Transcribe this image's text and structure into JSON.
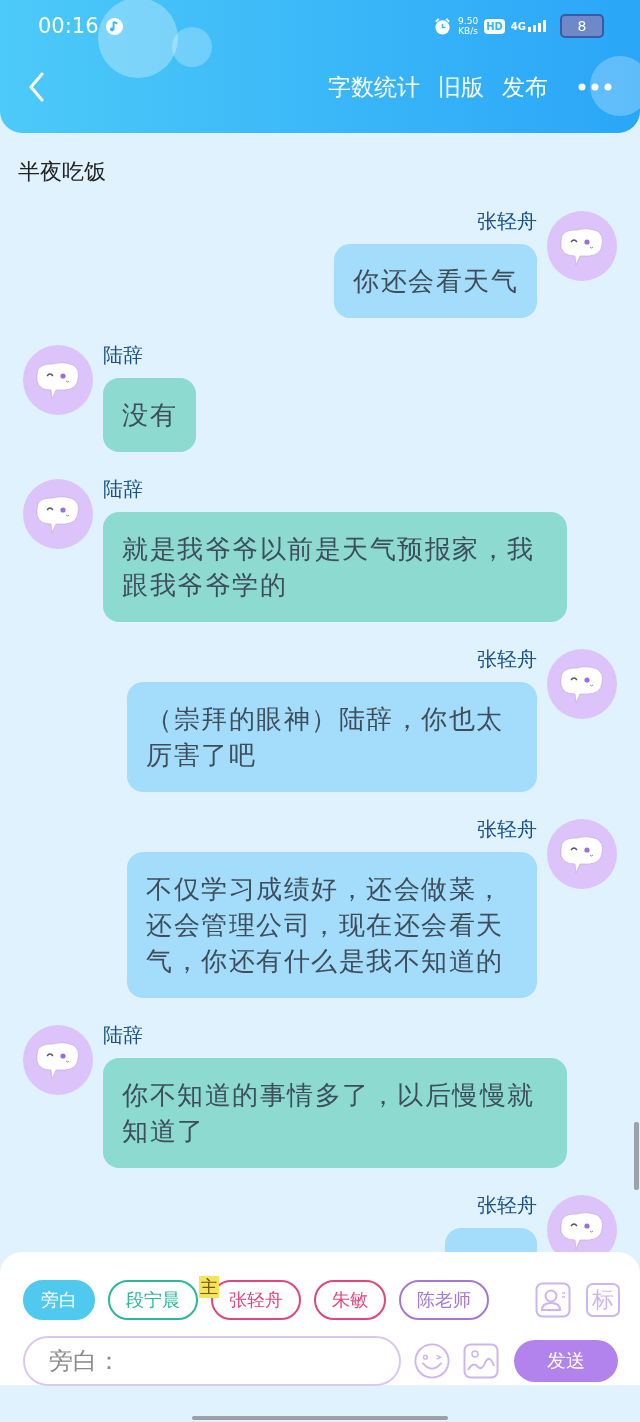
{
  "status_bar": {
    "time": "00:16",
    "net_speed": "9.50",
    "net_unit": "KB/s",
    "hd": "HD",
    "network": "4G",
    "battery": "8"
  },
  "header": {
    "actions": [
      "字数统计",
      "旧版",
      "发布"
    ]
  },
  "narration": "半夜吃饭",
  "messages": [
    {
      "outgoing": true,
      "name": "张轻舟",
      "text": "你还会看天气"
    },
    {
      "outgoing": false,
      "name": "陆辞",
      "text": "没有"
    },
    {
      "outgoing": false,
      "name": "陆辞",
      "text": "就是我爷爷以前是天气预报家，我跟我爷爷学的"
    },
    {
      "outgoing": true,
      "name": "张轻舟",
      "text": "（崇拜的眼神）陆辞，你也太厉害了吧"
    },
    {
      "outgoing": true,
      "name": "张轻舟",
      "text": "不仅学习成绩好，还会做菜，还会管理公司，现在还会看天气，你还有什么是我不知道的"
    },
    {
      "outgoing": false,
      "name": "陆辞",
      "text": "你不知道的事情多了，以后慢慢就知道了"
    },
    {
      "outgoing": true,
      "name": "张轻舟"
    }
  ],
  "roles": [
    {
      "label": "旁白",
      "selected": true,
      "color": "#4fc9ee"
    },
    {
      "label": "段宁晨",
      "selected": false,
      "color": "#2bb79a"
    },
    {
      "label": "张轻舟",
      "selected": false,
      "color": "#e0457f",
      "badge": "主"
    },
    {
      "label": "朱敏",
      "selected": false,
      "color": "#e0457f"
    },
    {
      "label": "陈老师",
      "selected": false,
      "color": "#a678d0"
    }
  ],
  "mark_button": "标",
  "input": {
    "placeholder": "旁白："
  },
  "send_button": "发送"
}
